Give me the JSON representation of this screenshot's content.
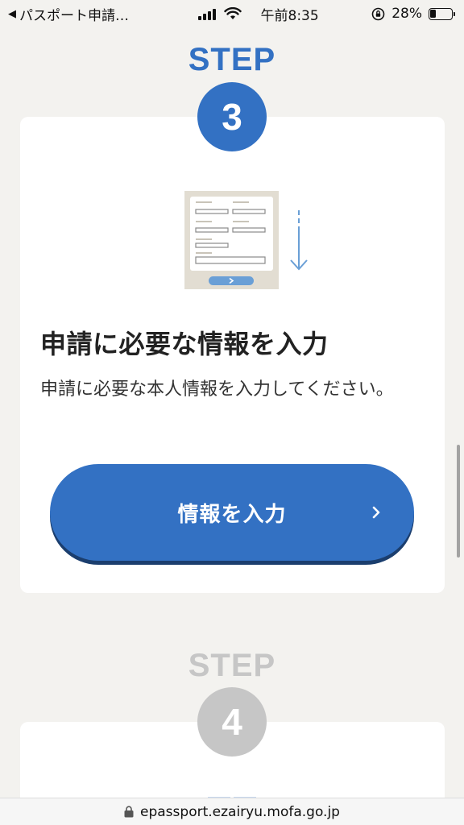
{
  "status_bar": {
    "back_app": "パスポート申請…",
    "time": "午前8:35",
    "battery_percent": "28%",
    "battery_level": 0.28
  },
  "steps": [
    {
      "label": "STEP",
      "number": "3",
      "state": "active",
      "title": "申請に必要な情報を入力",
      "description": "申請に必要な本人情報を入力してください。",
      "button_label": "情報を入力",
      "illustration": "form-entry-icon"
    },
    {
      "label": "STEP",
      "number": "4",
      "state": "inactive"
    }
  ],
  "colors": {
    "accent": "#3371c3",
    "accent_shadow": "#1b3e6e",
    "inactive": "#c6c6c6",
    "background": "#f3f2ef",
    "card": "#ffffff"
  },
  "url_bar": {
    "url": "epassport.ezairyu.mofa.go.jp"
  }
}
